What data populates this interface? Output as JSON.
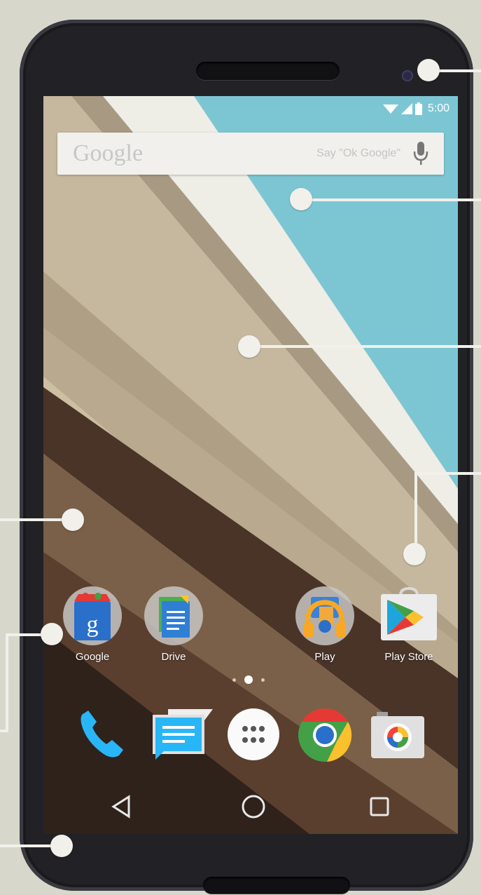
{
  "status_bar": {
    "time": "5:00"
  },
  "search": {
    "logo": "Google",
    "hint": "Say \"Ok Google\""
  },
  "home_apps": [
    {
      "label": "Google",
      "icon": "google-search-icon"
    },
    {
      "label": "Drive",
      "icon": "drive-icon"
    },
    {
      "label": "Play",
      "icon": "play-music-icon"
    },
    {
      "label": "Play Store",
      "icon": "play-store-icon"
    }
  ],
  "dock": [
    {
      "icon": "phone-icon"
    },
    {
      "icon": "messaging-icon"
    },
    {
      "icon": "app-drawer-icon"
    },
    {
      "icon": "chrome-icon"
    },
    {
      "icon": "camera-icon"
    }
  ],
  "page_indicator": {
    "pages": 3,
    "current": 2
  },
  "navigation": [
    "back-icon",
    "home-icon",
    "recents-icon"
  ],
  "colors": {
    "sky": "#7cc6d3",
    "wallpaper_light": "#cbbfa8",
    "wallpaper_dark": "#4a3428",
    "phone_body": "#222226",
    "callout": "#f1f0ea"
  }
}
